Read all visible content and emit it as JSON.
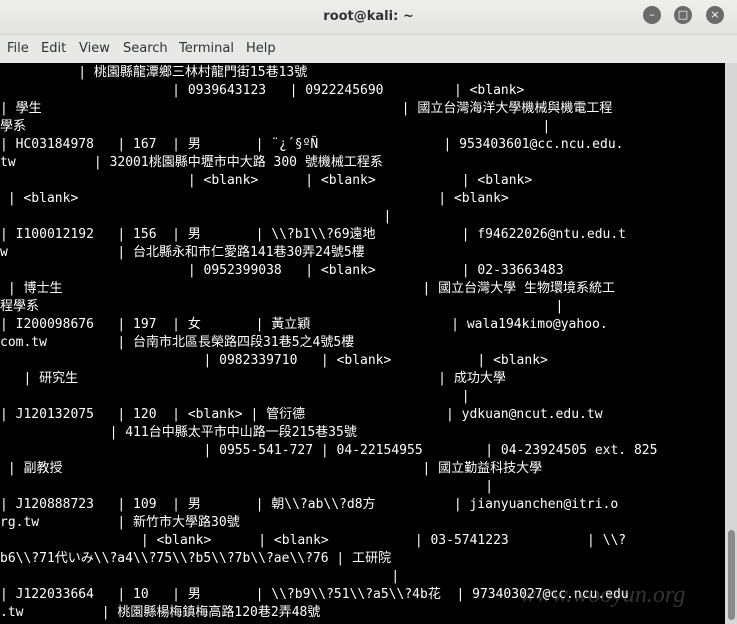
{
  "window": {
    "title": "root@kali: ~"
  },
  "menubar": [
    "File",
    "Edit",
    "View",
    "Search",
    "Terminal",
    "Help"
  ],
  "terminal": {
    "lines": [
      "          | 桃園縣龍潭鄉三林村龍門街15巷13號",
      "                      | 0939643123   | 0922245690         | <blank>",
      "| 學生                                              | 國立台灣海洋大學機械與機電工程",
      "學系                                                                  |",
      "| HC03184978   | 167  | 男       | ¨¿´§ºÑ                | 953403601@cc.ncu.edu.",
      "tw          | 32001桃園縣中壢市中大路 300 號機械工程系",
      "                        | <blank>      | <blank>           | <blank>",
      " | <blank>                                              | <blank>",
      "                                                 |",
      "| I100012192   | 156  | 男       | \\\\?b1\\\\?69遠地           | f94622026@ntu.edu.t",
      "w              | 台北縣永和市仁愛路141巷30弄24號5樓",
      "                        | 0952399038   | <blank>           | 02-33663483",
      " | 博士生                                              | 國立台灣大學 生物環境系統工",
      "程學系                                                                  |",
      "| I200098676   | 197  | 女       | 黃立穎                  | wala194kimo@yahoo.",
      "com.tw         | 台南市北區長榮路四段31巷5之4號5樓",
      "                          | 0982339710   | <blank>           | <blank>",
      "   | 研究生                                              | 成功大學",
      "                                                           |",
      "| J120132075   | 120  | <blank> | 管衍德                  | ydkuan@ncut.edu.tw",
      "              | 411台中縣太平市中山路一段215巷35號",
      "                          | 0955-541-727 | 04-22154955        | 04-23924505 ext. 825",
      " | 副教授                                              | 國立勤益科技大學",
      "                                                              |",
      "| J120888723   | 109  | 男       | 朝\\\\?ab\\\\?d8方          | jianyuanchen@itri.o",
      "rg.tw          | 新竹市大學路30號",
      "                  | <blank>      | <blank>           | 03-5741223          | \\\\?",
      "b6\\\\?71代いみ\\\\?a4\\\\?75\\\\?b5\\\\?7b\\\\?ae\\\\?76 | 工研院",
      "                                                  |",
      "| J122033664   | 10   | 男       | \\\\?b9\\\\?51\\\\?a5\\\\?4b花  | 973403027@cc.ncu.edu",
      ".tw          | 桃園縣楊梅鎮梅高路120巷2弄48號"
    ]
  },
  "watermark": "www.wooyun.org",
  "colors": {
    "terminal_bg": "#000000",
    "terminal_fg": "#ffffff",
    "chrome": "#e8e8e7"
  }
}
